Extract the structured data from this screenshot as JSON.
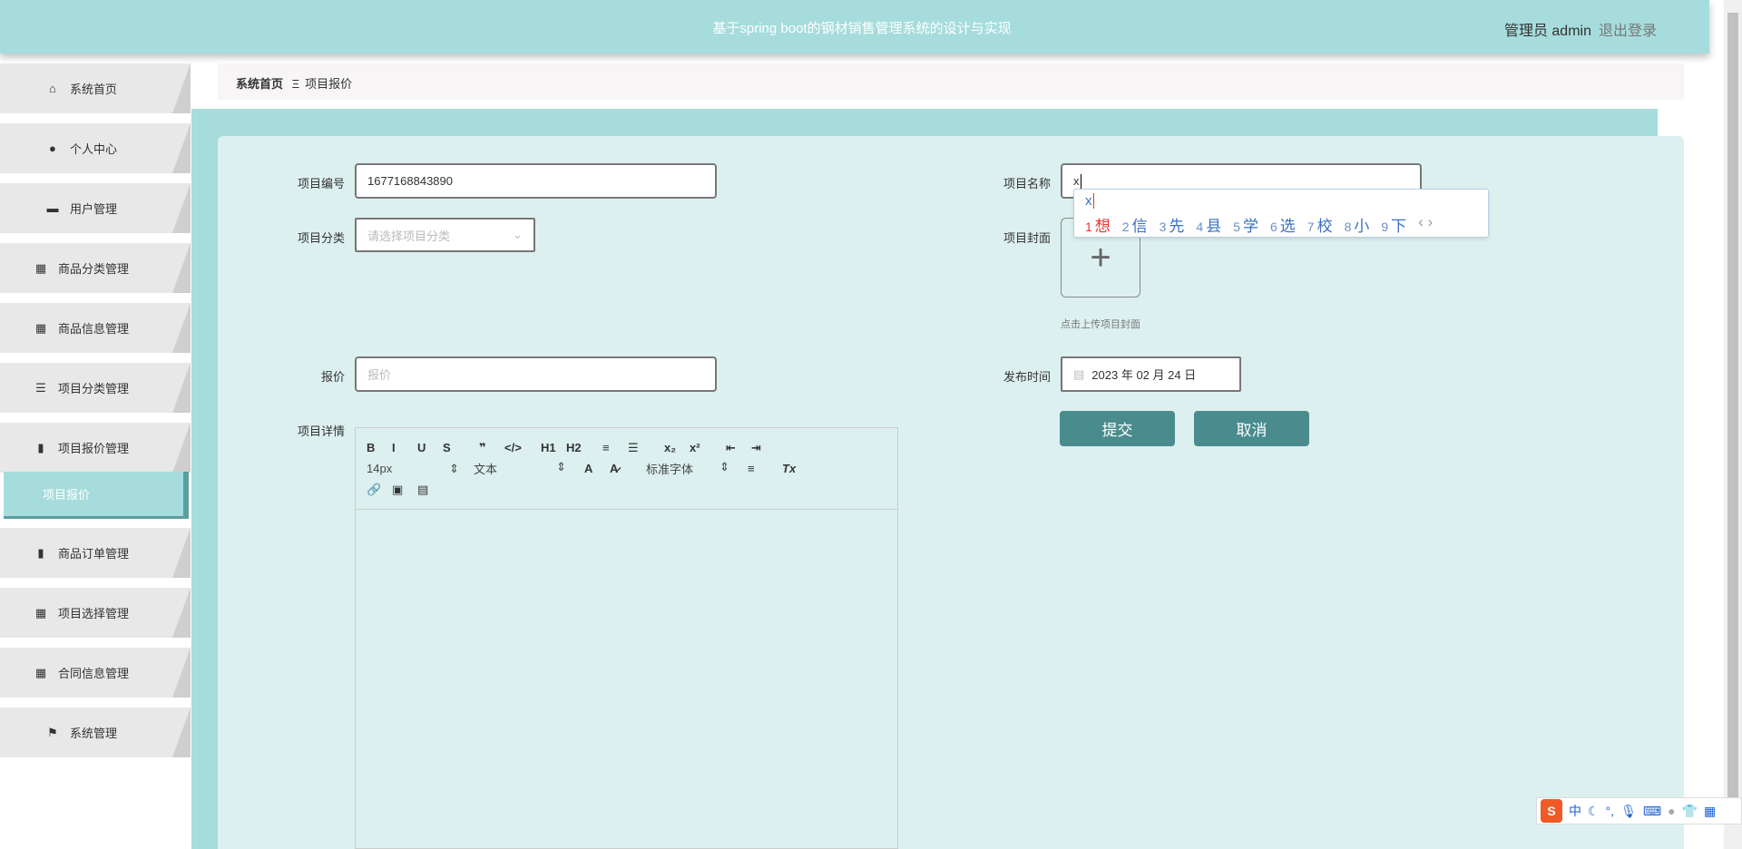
{
  "header": {
    "title": "基于spring boot的钢材销售管理系统的设计与实现",
    "user": "管理员 admin",
    "logout": "退出登录"
  },
  "sidebar": {
    "items": [
      {
        "label": "系统首页",
        "icon": "home-icon",
        "glyph": "⌂"
      },
      {
        "label": "个人中心",
        "icon": "user-icon",
        "glyph": "●"
      },
      {
        "label": "用户管理",
        "icon": "monitor-icon",
        "glyph": "▬"
      },
      {
        "label": "商品分类管理",
        "icon": "grid-icon",
        "glyph": "▦"
      },
      {
        "label": "商品信息管理",
        "icon": "grid-icon",
        "glyph": "▦"
      },
      {
        "label": "项目分类管理",
        "icon": "sliders-icon",
        "glyph": "☰"
      },
      {
        "label": "项目报价管理",
        "icon": "clipboard-icon",
        "glyph": "▮"
      },
      {
        "label": "项目报价",
        "icon": "",
        "glyph": "",
        "active": true
      },
      {
        "label": "商品订单管理",
        "icon": "clipboard-x-icon",
        "glyph": "▮"
      },
      {
        "label": "项目选择管理",
        "icon": "grid-icon",
        "glyph": "▦"
      },
      {
        "label": "合同信息管理",
        "icon": "grid-icon",
        "glyph": "▦"
      },
      {
        "label": "系统管理",
        "icon": "flag-icon",
        "glyph": "⚑"
      }
    ]
  },
  "breadcrumb": {
    "home": "系统首页",
    "sep": "Ξ",
    "current": "项目报价"
  },
  "form": {
    "code_label": "项目编号",
    "code_value": "1677168843890",
    "name_label": "项目名称",
    "name_value": "x",
    "category_label": "项目分类",
    "category_placeholder": "请选择项目分类",
    "cover_label": "项目封面",
    "cover_hint": "点击上传项目封面",
    "price_label": "报价",
    "price_placeholder": "报价",
    "date_label": "发布时间",
    "date_value": "2023 年 02 月 24 日",
    "detail_label": "项目详情",
    "submit": "提交",
    "cancel": "取消"
  },
  "editor": {
    "row1": [
      "B",
      "I",
      "U",
      "S",
      "❞",
      "</>",
      "H1",
      "H2",
      "≡",
      "☰",
      "x₂",
      "x²",
      "⇤",
      "⇥"
    ],
    "font_size": "14px",
    "block": "文本",
    "font_family": "标准字体",
    "row2_icons": [
      "A",
      "A̷",
      "≡",
      "Tx"
    ],
    "row3": [
      "🔗",
      "▣",
      "▤"
    ]
  },
  "ime": {
    "composition": "x",
    "candidates": [
      "想",
      "信",
      "先",
      "县",
      "学",
      "选",
      "校",
      "小",
      "下"
    ]
  },
  "sogou": {
    "lang": "中"
  }
}
